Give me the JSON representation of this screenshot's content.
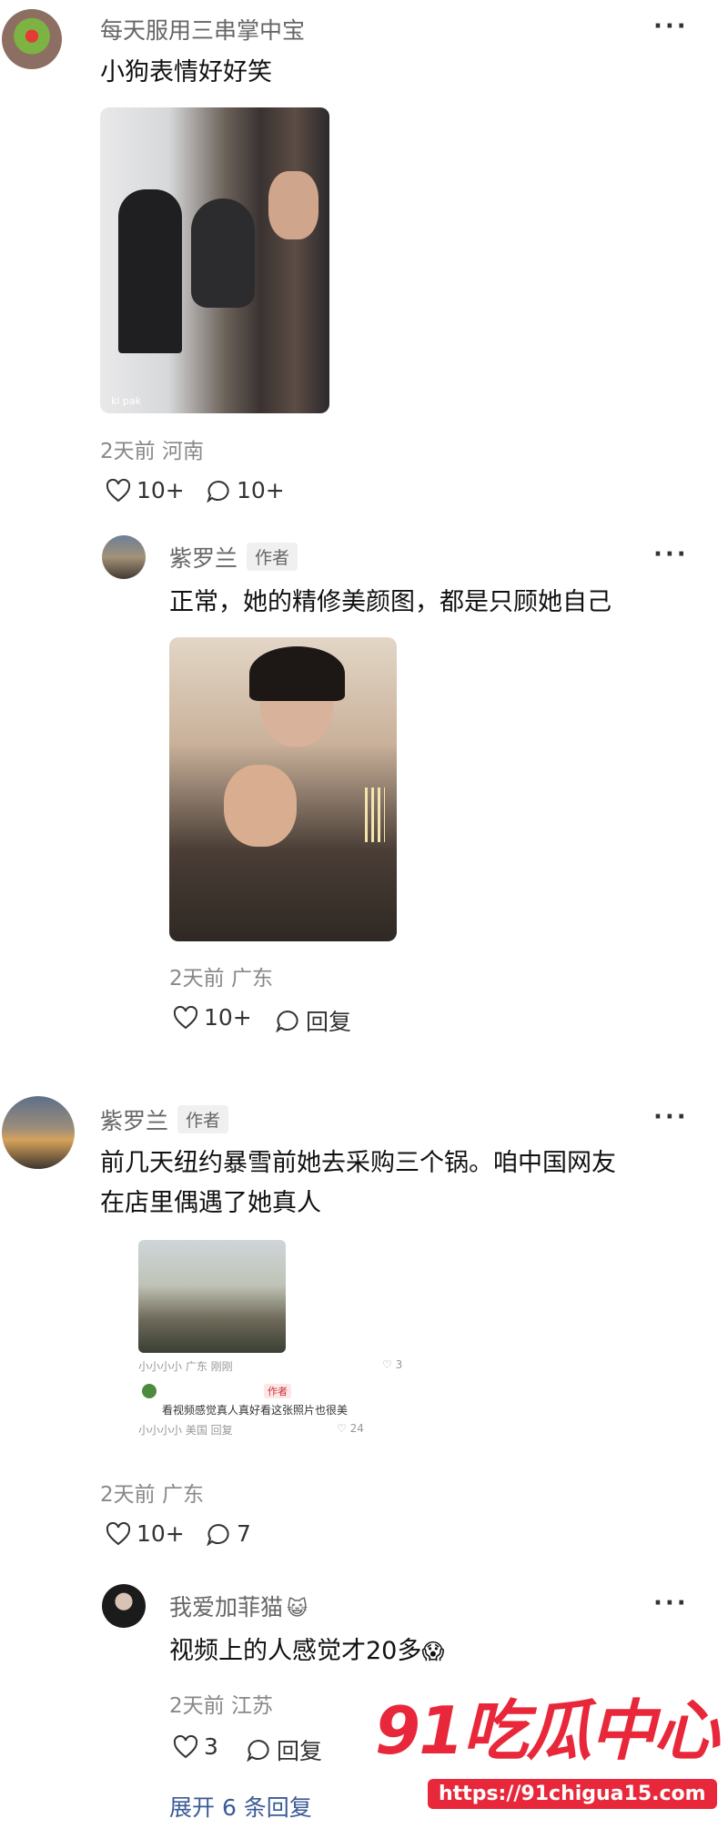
{
  "comments": [
    {
      "username": "每天服用三串掌中宝",
      "text": "小狗表情好好笑",
      "meta": "2天前 河南",
      "like_count": "10+",
      "reply_count": "10+",
      "photo_overlay": "ki pak"
    },
    {
      "username": "紫罗兰",
      "tag": "作者",
      "text": "正常，她的精修美颜图，都是只顾她自己",
      "meta": "2天前 广东",
      "like_count": "10+",
      "reply_label": "回复"
    },
    {
      "username": "紫罗兰",
      "tag": "作者",
      "text_line1": "前几天纽约暴雪前她去采购三个锅。咱中国网友",
      "text_line2": "在店里偶遇了她真人",
      "meta": "2天前 广东",
      "like_count": "10+",
      "reply_count": "7",
      "embedded": {
        "meta1": "小小小小 广东 刚刚",
        "like1": "3",
        "tag": "作者",
        "text": "看视频感觉真人真好看这张照片也很美",
        "meta2": "小小小小 美国 回复",
        "like2": "24"
      }
    },
    {
      "username": "我爱加菲猫",
      "emoji": "😺",
      "text": "视频上的人感觉才20多",
      "text_emoji": "😱",
      "meta": "2天前 江苏",
      "like_count": "3",
      "reply_label": "回复"
    }
  ],
  "more_glyph": "···",
  "expand_label": "展开 6 条回复",
  "watermark": {
    "brand": "91吃瓜中心",
    "url": "https://91chigua15.com"
  }
}
